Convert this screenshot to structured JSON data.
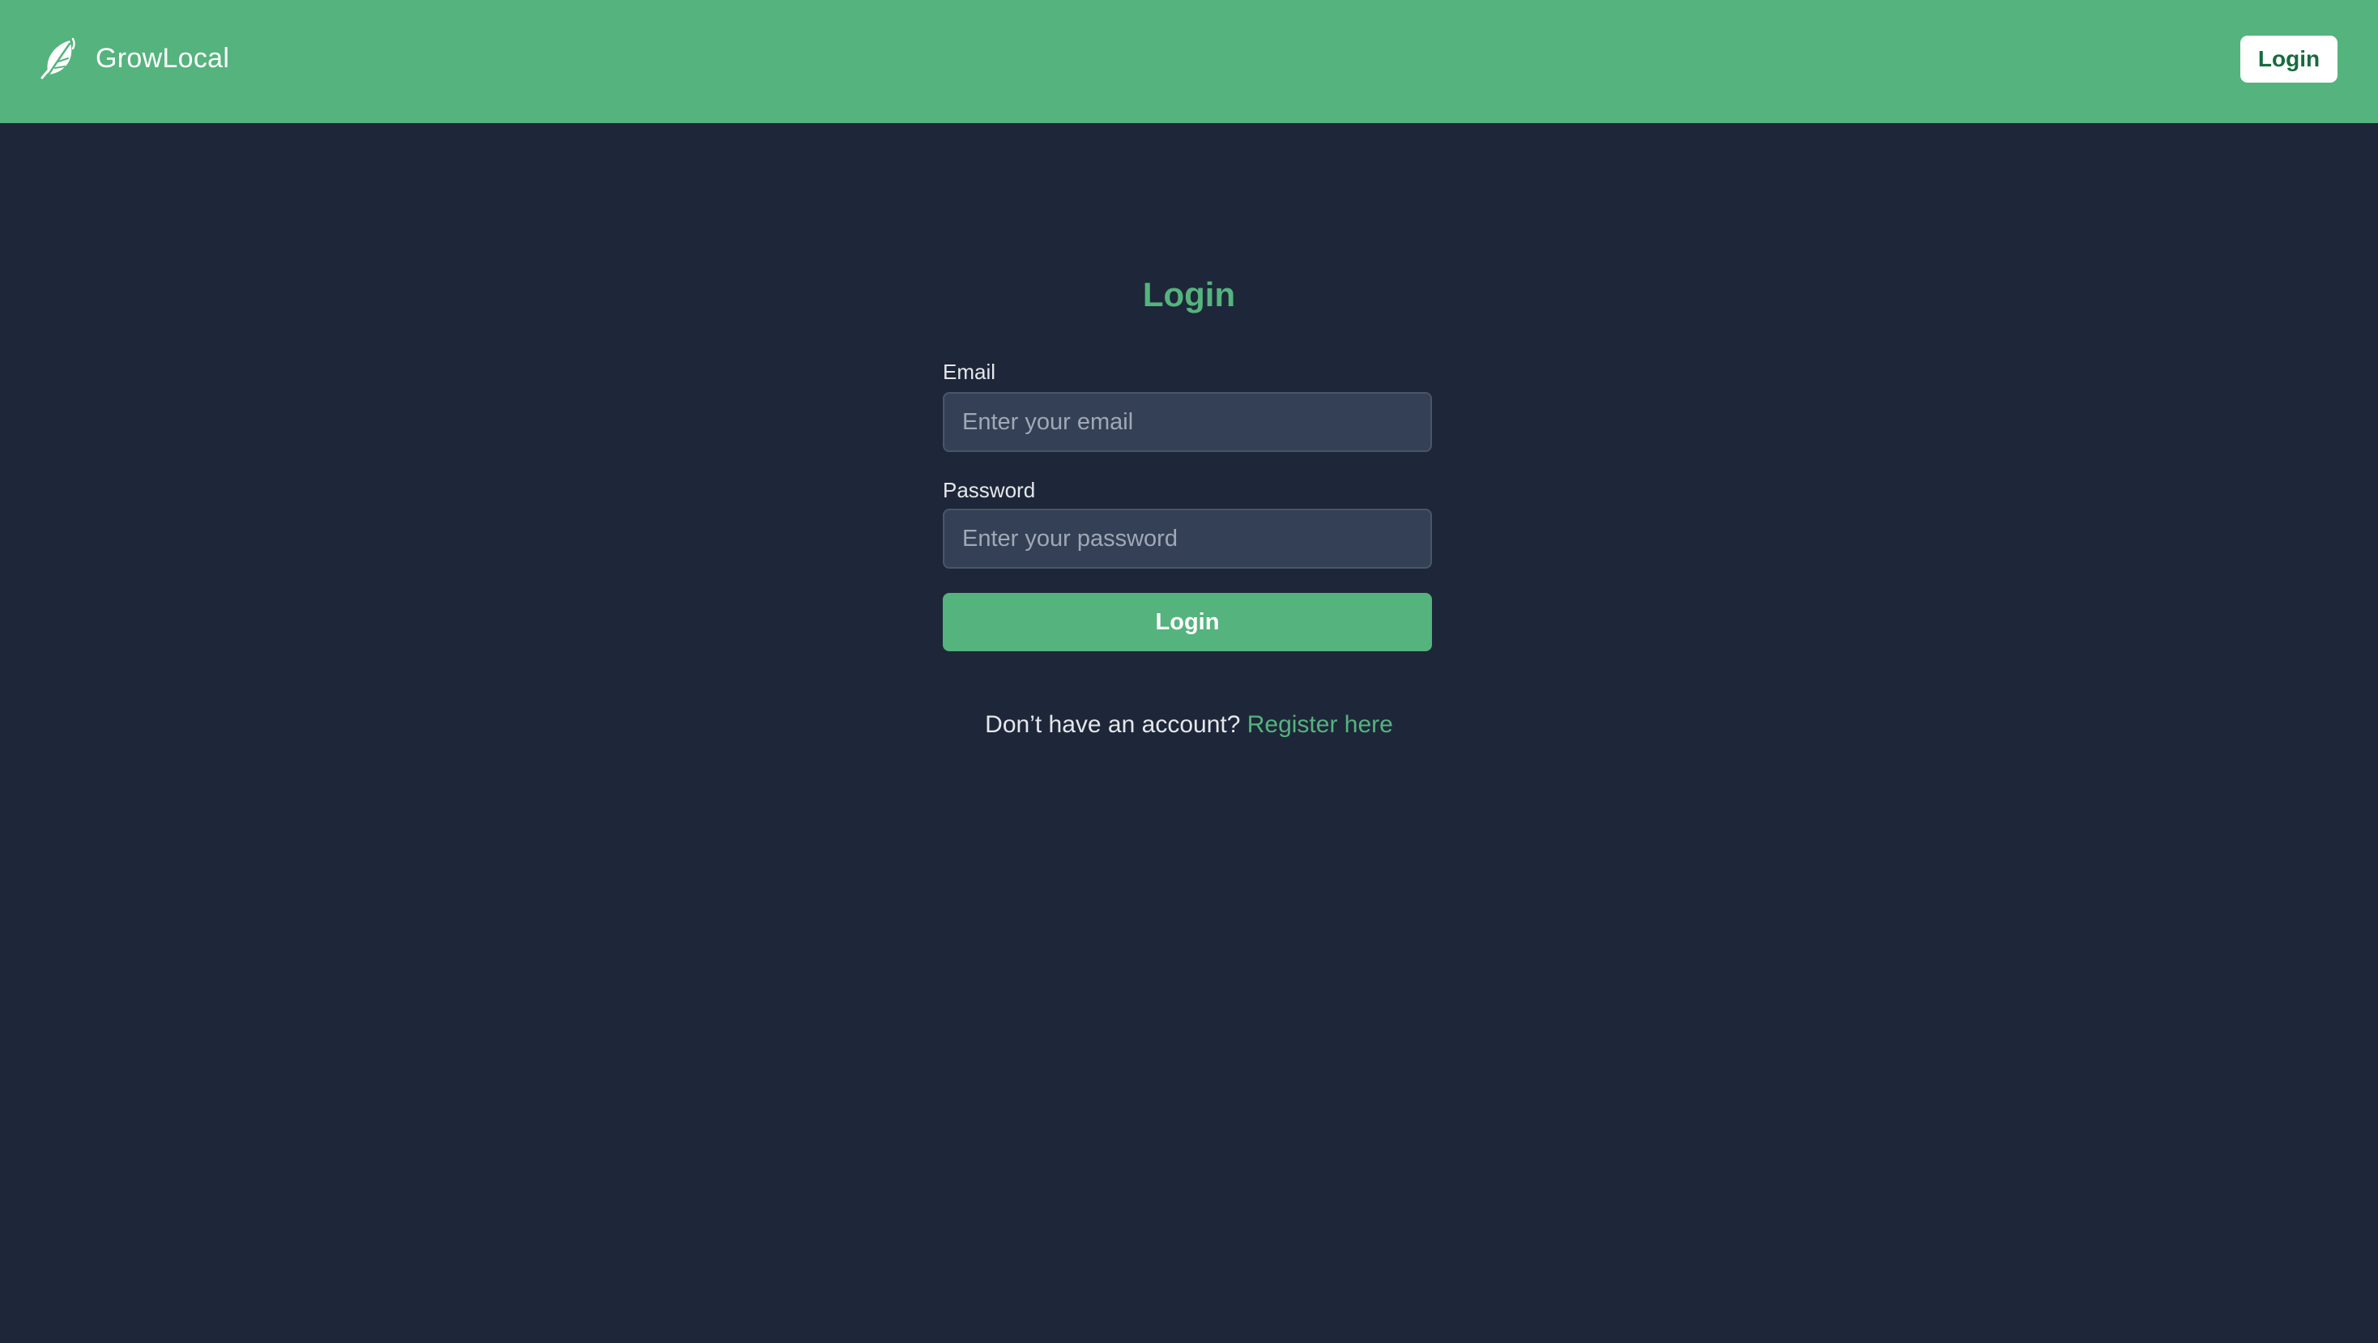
{
  "header": {
    "brand_name": "GrowLocal",
    "logo_icon": "leaf-logo-icon",
    "login_label": "Login"
  },
  "form": {
    "title": "Login",
    "email_label": "Email",
    "email_placeholder": "Enter your email",
    "email_value": "",
    "password_label": "Password",
    "password_placeholder": "Enter your password",
    "password_value": "",
    "submit_label": "Login"
  },
  "register": {
    "prompt": "Don’t have an account?",
    "link_label": "Register here"
  },
  "colors": {
    "accent": "#55b37e",
    "background": "#1e2739",
    "input_background": "#344055",
    "header_login_text": "#166b3e"
  }
}
